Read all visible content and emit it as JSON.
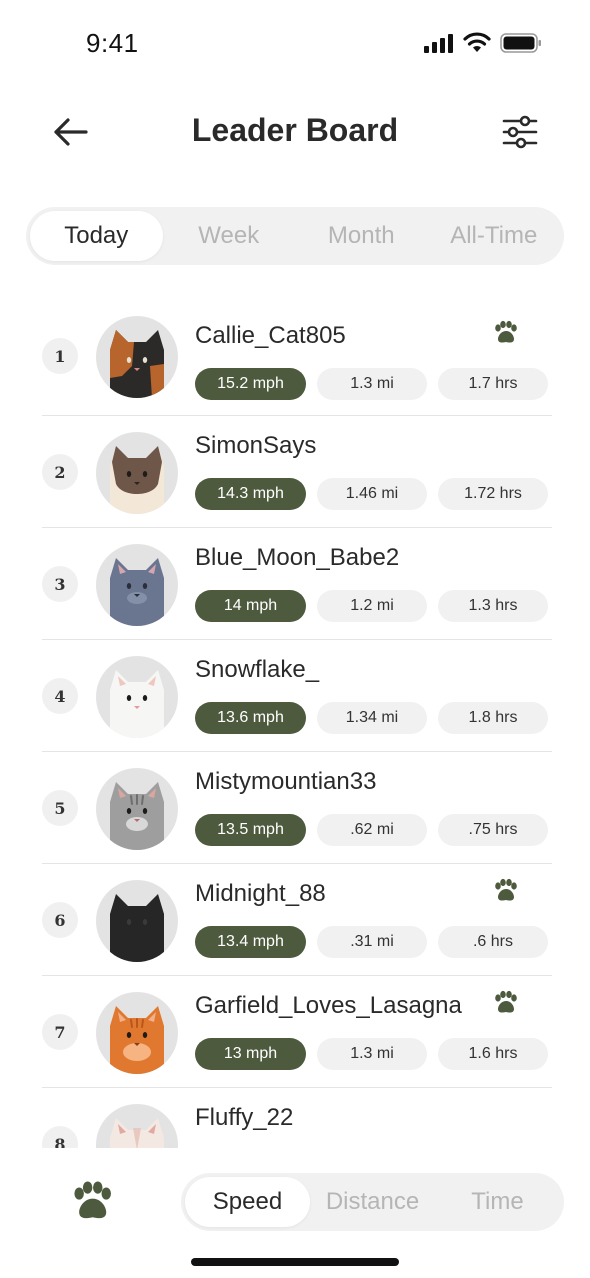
{
  "status": {
    "time": "9:41"
  },
  "header": {
    "title": "Leader Board",
    "back_icon": "arrow-left-icon",
    "filter_icon": "sliders-icon"
  },
  "period_tabs": [
    {
      "label": "Today",
      "active": true
    },
    {
      "label": "Week",
      "active": false
    },
    {
      "label": "Month",
      "active": false
    },
    {
      "label": "All-Time",
      "active": false
    }
  ],
  "leaderboard": [
    {
      "rank": "1",
      "name": "Callie_Cat805",
      "speed": "15.2 mph",
      "distance": "1.3 mi",
      "time": "1.7 hrs",
      "paw": true,
      "cat": "calico"
    },
    {
      "rank": "2",
      "name": "SimonSays",
      "speed": "14.3 mph",
      "distance": "1.46 mi",
      "time": "1.72 hrs",
      "paw": false,
      "cat": "siamese"
    },
    {
      "rank": "3",
      "name": "Blue_Moon_Babe2",
      "speed": "14 mph",
      "distance": "1.2 mi",
      "time": "1.3 hrs",
      "paw": false,
      "cat": "blue"
    },
    {
      "rank": "4",
      "name": "Snowflake_",
      "speed": "13.6 mph",
      "distance": "1.34 mi",
      "time": "1.8 hrs",
      "paw": false,
      "cat": "white"
    },
    {
      "rank": "5",
      "name": "Mistymountian33",
      "speed": "13.5 mph",
      "distance": ".62 mi",
      "time": ".75 hrs",
      "paw": false,
      "cat": "gray-tabby"
    },
    {
      "rank": "6",
      "name": "Midnight_88",
      "speed": "13.4 mph",
      "distance": ".31 mi",
      "time": ".6 hrs",
      "paw": true,
      "cat": "black"
    },
    {
      "rank": "7",
      "name": "Garfield_Loves_Lasagna",
      "speed": "13 mph",
      "distance": "1.3 mi",
      "time": "1.6 hrs",
      "paw": true,
      "cat": "orange"
    },
    {
      "rank": "8",
      "name": "Fluffy_22",
      "speed": "",
      "distance": "",
      "time": "",
      "paw": false,
      "cat": "cream"
    }
  ],
  "metric_tabs": [
    {
      "label": "Speed",
      "active": true
    },
    {
      "label": "Distance",
      "active": false
    },
    {
      "label": "Time",
      "active": false
    }
  ],
  "colors": {
    "accent": "#4d5a3d",
    "pill_bg": "#f1f1f1",
    "inactive_text": "#b5b5b5"
  }
}
